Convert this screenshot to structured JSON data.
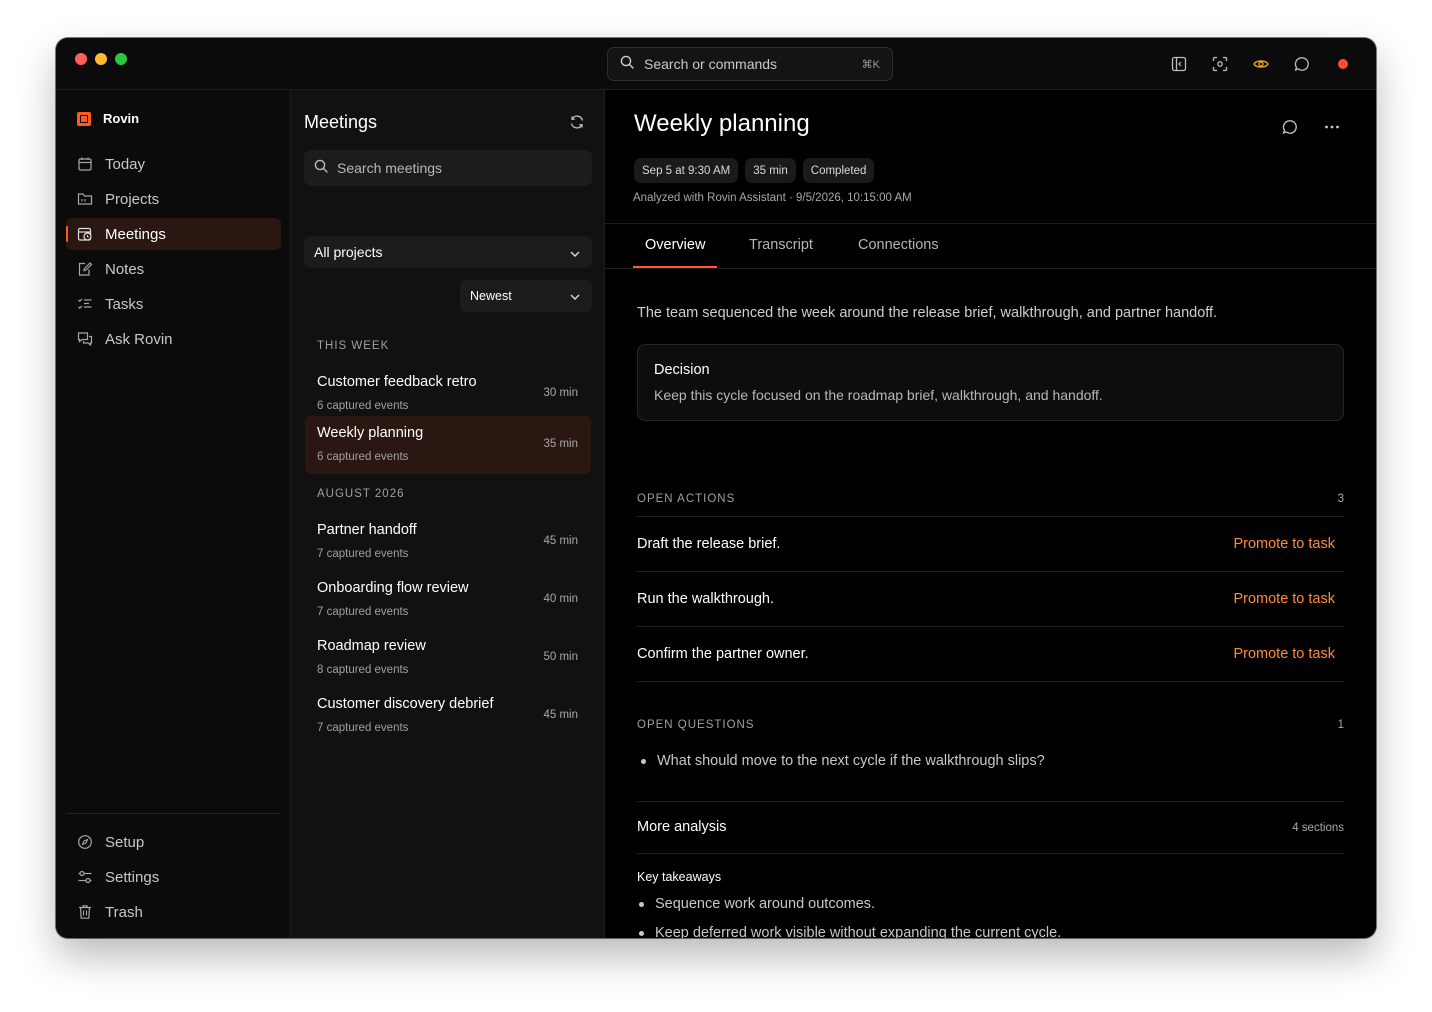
{
  "titlebar": {
    "search_placeholder": "Search or commands",
    "search_shortcut": "⌘K",
    "icons": [
      "sidebar-toggle-icon",
      "capture-icon",
      "eye-icon",
      "chat-icon",
      "record-dot-icon"
    ],
    "accent": "#ff5a1f"
  },
  "sidebar": {
    "brand": "Rovin",
    "items": [
      {
        "label": "Today",
        "icon": "calendar-icon"
      },
      {
        "label": "Projects",
        "icon": "folder-icon"
      },
      {
        "label": "Meetings",
        "icon": "meeting-icon",
        "active": true
      },
      {
        "label": "Notes",
        "icon": "note-icon"
      },
      {
        "label": "Tasks",
        "icon": "tasks-icon"
      },
      {
        "label": "Ask Rovin",
        "icon": "chat-icon"
      }
    ],
    "bottom_items": [
      {
        "label": "Setup",
        "icon": "compass-icon"
      },
      {
        "label": "Settings",
        "icon": "sliders-icon"
      },
      {
        "label": "Trash",
        "icon": "trash-icon"
      }
    ]
  },
  "list": {
    "title": "Meetings",
    "search_placeholder": "Search meetings",
    "project_filter": "All projects",
    "sort": "Newest",
    "groups": [
      {
        "label": "THIS WEEK",
        "meetings": [
          {
            "title": "Customer feedback retro",
            "sub": "6 captured events",
            "duration": "30 min"
          },
          {
            "title": "Weekly planning",
            "sub": "6 captured events",
            "duration": "35 min",
            "active": true
          }
        ]
      },
      {
        "label": "AUGUST 2026",
        "meetings": [
          {
            "title": "Partner handoff",
            "sub": "7 captured events",
            "duration": "45 min"
          },
          {
            "title": "Onboarding flow review",
            "sub": "7 captured events",
            "duration": "40 min"
          },
          {
            "title": "Roadmap review",
            "sub": "8 captured events",
            "duration": "50 min"
          },
          {
            "title": "Customer discovery debrief",
            "sub": "7 captured events",
            "duration": "45 min"
          }
        ]
      }
    ]
  },
  "detail": {
    "title": "Weekly planning",
    "chips": [
      "Sep 5 at 9:30 AM",
      "35 min",
      "Completed"
    ],
    "analyzed": "Analyzed with Rovin Assistant · 9/5/2026, 10:15:00 AM",
    "tabs": [
      "Overview",
      "Transcript",
      "Connections"
    ],
    "summary": "The team sequenced the week around the release brief, walkthrough, and partner handoff.",
    "decision": {
      "label": "Decision",
      "text": "Keep this cycle focused on the roadmap brief, walkthrough, and handoff."
    },
    "open_actions": {
      "label": "OPEN ACTIONS",
      "count": "3",
      "promote_label": "Promote to task",
      "items": [
        "Draft the release brief.",
        "Run the walkthrough.",
        "Confirm the partner owner."
      ]
    },
    "open_questions": {
      "label": "OPEN QUESTIONS",
      "count": "1",
      "items": [
        "What should move to the next cycle if the walkthrough slips?"
      ]
    },
    "more_analysis": {
      "title": "More analysis",
      "count": "4 sections",
      "section_title": "Key takeaways",
      "items": [
        "Sequence work around outcomes.",
        "Keep deferred work visible without expanding the current cycle."
      ]
    }
  }
}
